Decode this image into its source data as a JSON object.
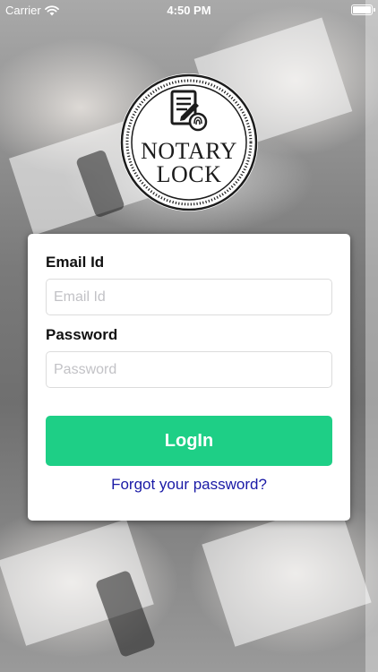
{
  "status_bar": {
    "carrier": "Carrier",
    "time": "4:50 PM",
    "wifi_icon": "wifi-icon",
    "battery_icon": "battery-icon"
  },
  "logo": {
    "line1": "NOTARY",
    "line2": "LOCK",
    "icon": "document-fingerprint-icon"
  },
  "login_form": {
    "email_label": "Email Id",
    "email_value": "",
    "email_placeholder": "Email Id",
    "password_label": "Password",
    "password_value": "",
    "password_placeholder": "Password",
    "login_label": "LogIn",
    "forgot_label": "Forgot your password?"
  },
  "colors": {
    "login_button": "#1ecf86",
    "link": "#1a1aa6",
    "card_background": "#ffffff"
  }
}
